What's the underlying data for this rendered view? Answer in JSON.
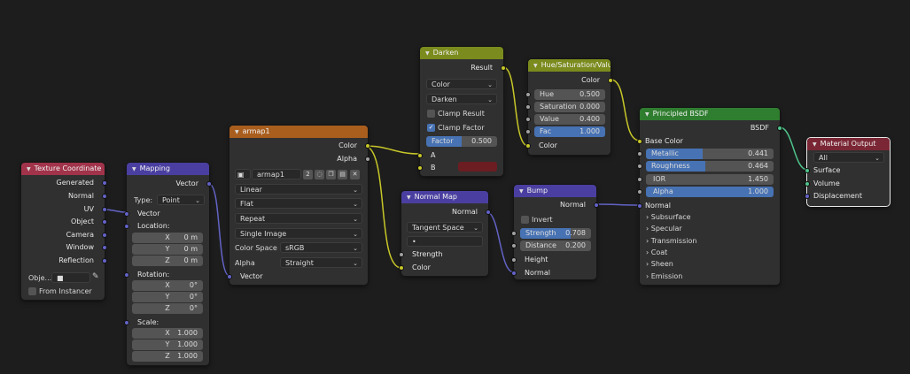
{
  "colors": {
    "input_header": "#a1334a",
    "vector_header": "#4a3fa0",
    "texture_header": "#a95e1e",
    "color_header": "#7b8b1d",
    "shader_header": "#2f7d2f",
    "output_header": "#7a2634",
    "socket_grey": "#a1a1a1",
    "socket_yellow": "#c7c729",
    "socket_purple": "#6363c7",
    "accent": "#4772b3"
  },
  "texcoord": {
    "title": "Texture Coordinate",
    "outputs": [
      "Generated",
      "Normal",
      "UV",
      "Object",
      "Camera",
      "Window",
      "Reflection"
    ],
    "object_label": "Obje...",
    "from_instancer": "From Instancer"
  },
  "mapping": {
    "title": "Mapping",
    "out_vector": "Vector",
    "type_label": "Type:",
    "type_value": "Point",
    "in_vector": "Vector",
    "location_label": "Location:",
    "location": [
      {
        "axis": "X",
        "value": "0 m"
      },
      {
        "axis": "Y",
        "value": "0 m"
      },
      {
        "axis": "Z",
        "value": "0 m"
      }
    ],
    "rotation_label": "Rotation:",
    "rotation": [
      {
        "axis": "X",
        "value": "0°"
      },
      {
        "axis": "Y",
        "value": "0°"
      },
      {
        "axis": "Z",
        "value": "0°"
      }
    ],
    "scale_label": "Scale:",
    "scale": [
      {
        "axis": "X",
        "value": "1.000"
      },
      {
        "axis": "Y",
        "value": "1.000"
      },
      {
        "axis": "Z",
        "value": "1.000"
      }
    ]
  },
  "image": {
    "title": "armap1",
    "out_color": "Color",
    "out_alpha": "Alpha",
    "image_name": "armap1",
    "users": "2",
    "interpolation": "Linear",
    "projection": "Flat",
    "extension": "Repeat",
    "source": "Single Image",
    "colorspace_label": "Color Space",
    "colorspace_value": "sRGB",
    "alpha_label": "Alpha",
    "alpha_value": "Straight",
    "in_vector": "Vector"
  },
  "darken": {
    "title": "Darken",
    "out_result": "Result",
    "mode1": "Color",
    "mode2": "Darken",
    "clamp_result": "Clamp Result",
    "clamp_factor": "Clamp Factor",
    "factor_label": "Factor",
    "factor_value": "0.500",
    "in_a": "A",
    "in_b": "B",
    "b_color": "#6b1d22"
  },
  "hsv": {
    "title": "Hue/Saturation/Value",
    "out_color": "Color",
    "hue_label": "Hue",
    "hue_value": "0.500",
    "sat_label": "Saturation",
    "sat_value": "0.000",
    "val_label": "Value",
    "val_value": "0.400",
    "fac_label": "Fac",
    "fac_value": "1.000",
    "in_color": "Color"
  },
  "normalmap": {
    "title": "Normal Map",
    "out_normal": "Normal",
    "space": "Tangent Space",
    "uv_value": "•",
    "in_strength": "Strength",
    "in_color": "Color"
  },
  "bump": {
    "title": "Bump",
    "out_normal": "Normal",
    "invert": "Invert",
    "strength_label": "Strength",
    "strength_value": "0.708",
    "distance_label": "Distance",
    "distance_value": "0.200",
    "in_height": "Height",
    "in_normal": "Normal"
  },
  "bsdf": {
    "title": "Principled BSDF",
    "out_bsdf": "BSDF",
    "base_color": "Base Color",
    "metallic_label": "Metallic",
    "metallic_value": "0.441",
    "metallic_fill": 0.441,
    "roughness_label": "Roughness",
    "roughness_value": "0.464",
    "roughness_fill": 0.464,
    "ior_label": "IOR",
    "ior_value": "1.450",
    "alpha_label": "Alpha",
    "alpha_value": "1.000",
    "alpha_fill": 1.0,
    "in_normal": "Normal",
    "panels": [
      "Subsurface",
      "Specular",
      "Transmission",
      "Coat",
      "Sheen",
      "Emission"
    ]
  },
  "output": {
    "title": "Material Output",
    "target": "All",
    "in_surface": "Surface",
    "in_volume": "Volume",
    "in_displacement": "Displacement"
  }
}
